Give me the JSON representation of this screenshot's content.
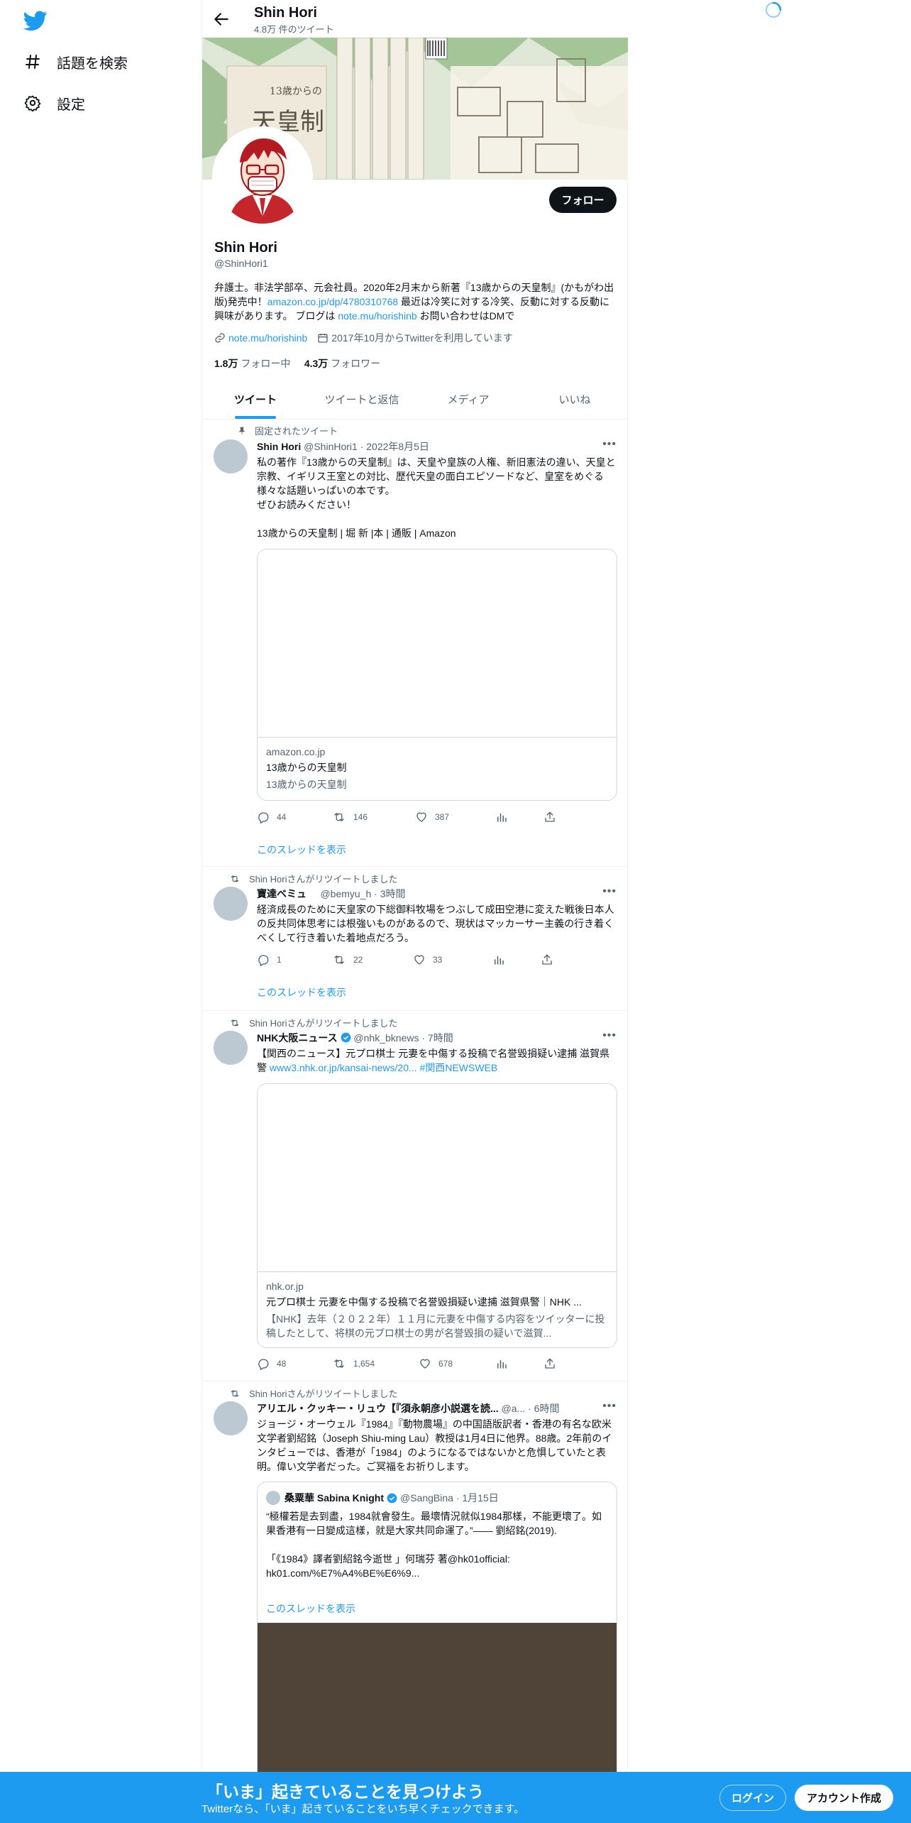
{
  "nav": {
    "explore_label": "話題を検索",
    "settings_label": "設定"
  },
  "header": {
    "name": "Shin Hori",
    "tweet_count": "4.8万 件のツイート"
  },
  "profile": {
    "follow_label": "フォロー",
    "name": "Shin Hori",
    "handle": "@ShinHori1",
    "bio_1": "弁護士。非法学部卒、元会社員。2020年2月末から新著『13歳からの天皇制』(かもがわ出版)発売中！",
    "bio_link": "amazon.co.jp/dp/4780310768",
    "bio_2": " 最近は冷笑に対する冷笑、反動に対する反動に興味があります。 ブログは ",
    "bio_link2": "note.mu/horishinb",
    "bio_3": " お問い合わせはDMで",
    "website": "note.mu/horishinb",
    "joined": "2017年10月からTwitterを利用しています",
    "following_count": "1.8万",
    "following_label": "フォロー中",
    "followers_count": "4.3万",
    "followers_label": "フォロワー"
  },
  "tabs": [
    "ツイート",
    "ツイートと返信",
    "メディア",
    "いいね"
  ],
  "tweets": [
    {
      "social": "固定されたツイート",
      "name": "Shin Hori",
      "handle": "@ShinHori1",
      "time": "· 2022年8月5日",
      "text": "私の著作『13歳からの天皇制』は、天皇や皇族の人権、新旧憲法の違い、天皇と宗教、イギリス王室との対比、歴代天皇の面白エピソードなど、皇室をめぐる様々な話題いっぱいの本です。\nぜひお読みください！\n\n13歳からの天皇制 | 堀 新 |本 | 通販 | Amazon",
      "card": {
        "domain": "amazon.co.jp",
        "title": "13歳からの天皇制",
        "desc": "13歳からの天皇制"
      },
      "replies": "44",
      "retweets": "146",
      "likes": "387",
      "thread": "このスレッドを表示"
    },
    {
      "social": "Shin Horiさんがリツイートしました",
      "name": "寶達ベミュ",
      "handle": "@bemyu_h",
      "time": "· 3時間",
      "text": "経済成長のために天皇家の下総御料牧場をつぶして成田空港に変えた戦後日本人の反共同体思考には根強いものがあるので、現状はマッカーサー主義の行き着くべくして行き着いた着地点だろう。",
      "replies": "1",
      "retweets": "22",
      "likes": "33",
      "thread": "このスレッドを表示"
    },
    {
      "social": "Shin Horiさんがリツイートしました",
      "name": "NHK大阪ニュース",
      "handle": "@nhk_bknews",
      "time": "· 7時間",
      "text_pre": "【関西のニュース】元プロ棋士 元妻を中傷する投稿で名誉毀損疑い逮捕 滋賀県警 ",
      "text_link": "www3.nhk.or.jp/kansai-news/20...",
      "text_tag": " #関西NEWSWEB",
      "card": {
        "domain": "nhk.or.jp",
        "title": "元プロ棋士 元妻を中傷する投稿で名誉毀損疑い逮捕 滋賀県警｜NHK ...",
        "desc": "【NHK】去年（２０２２年）１１月に元妻を中傷する内容をツイッターに投稿したとして、将棋の元プロ棋士の男が名誉毀損の疑いで滋賀..."
      },
      "replies": "48",
      "retweets": "1,654",
      "likes": "678"
    },
    {
      "social": "Shin Horiさんがリツイートしました",
      "name": "アリエル・クッキー・リュウ【『須永朝彦小説選を読...",
      "handle": "@a...",
      "time": "· 6時間",
      "text": "ジョージ・オーウェル『1984』『動物農場』の中国語版訳者・香港の有名な欧米文学者劉紹銘（Joseph Shiu-ming Lau）教授は1月4日に他界。88歳。2年前のインタビューでは、香港が「1984」のようになるではないかと危惧していたと表明。偉い文学者だった。ご冥福をお祈りします。",
      "quote": {
        "name": "桑粟華 Sabina Knight",
        "handle": "@SangBina",
        "time": "· 1月15日",
        "text": "“極權若是去到盡，1984就會發生。最壞情況就似1984那樣，不能更壞了。如果香港有一日變成這樣，就是大家共同命運了。”—— 劉紹銘(2019).\n\n「《1984》譯者劉紹銘今逝世 」何瑞芬 著@hk01official:\nhk01.com/%E7%A4%BE%E6%9...",
        "thread": "このスレッドを表示"
      }
    }
  ],
  "bottom": {
    "title": "「いま」起きていることを見つけよう",
    "subtitle": "Twitterなら、「いま」起きていることをいち早くチェックできます。",
    "login": "ログイン",
    "signup": "アカウント作成"
  },
  "colors": {
    "accent": "#1d9bf0",
    "text": "#0f1419",
    "secondary": "#536471"
  }
}
